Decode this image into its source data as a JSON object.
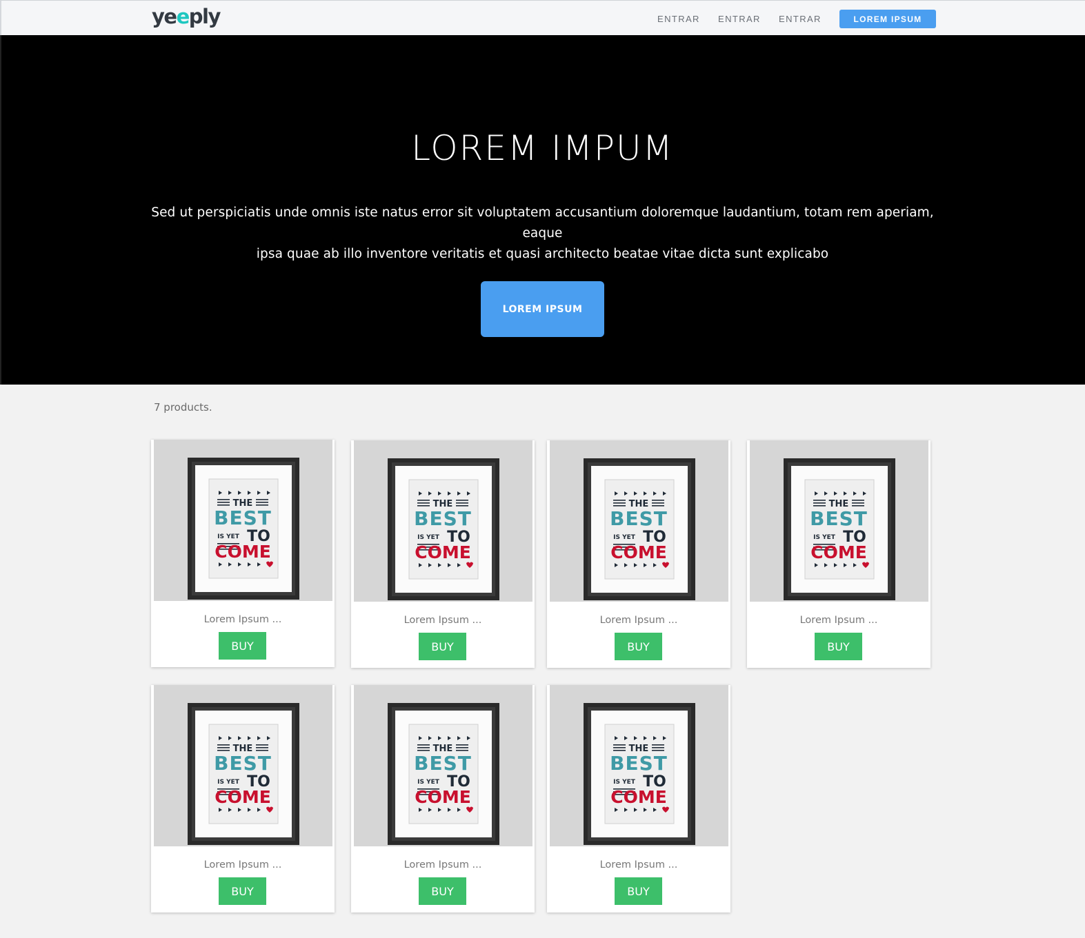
{
  "brand": {
    "logo_prefix": "ye",
    "logo_accent": "e",
    "logo_suffix": "ply",
    "accent_color": "#1ec7c0"
  },
  "nav": {
    "links": [
      "ENTRAR",
      "ENTRAR",
      "ENTRAR"
    ],
    "cta": "LOREM IPSUM",
    "cta_color": "#4a9ef0"
  },
  "hero": {
    "title": "LOREM IMPUM",
    "text_line1": "Sed ut perspiciatis unde omnis iste natus error sit voluptatem accusantium doloremque laudantium, totam rem aperiam, eaque",
    "text_line2": "ipsa quae ab illo inventore veritatis et quasi architecto beatae vitae dicta sunt explicabo",
    "button": "LOREM IPSUM"
  },
  "products_count": "7 products.",
  "poster": {
    "the": "THE",
    "best": "BEST",
    "is_yet": "IS YET",
    "to": "TO",
    "come": "COME",
    "colors": {
      "best": "#3f9aa6",
      "come": "#c8102e",
      "dark": "#1f2a36"
    }
  },
  "products": [
    {
      "name": "Lorem Ipsum ...",
      "buy": "BUY"
    },
    {
      "name": "Lorem Ipsum ...",
      "buy": "BUY"
    },
    {
      "name": "Lorem Ipsum ...",
      "buy": "BUY"
    },
    {
      "name": "Lorem Ipsum ...",
      "buy": "BUY"
    },
    {
      "name": "Lorem Ipsum ...",
      "buy": "BUY"
    },
    {
      "name": "Lorem Ipsum ...",
      "buy": "BUY"
    },
    {
      "name": "Lorem Ipsum ...",
      "buy": "BUY"
    }
  ],
  "buy_color": "#3dbf6a"
}
